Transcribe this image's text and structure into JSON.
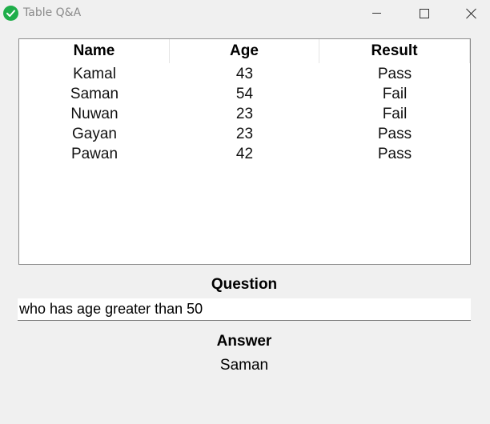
{
  "window": {
    "title": "Table Q&A",
    "icon": "check-circle-icon",
    "controls": [
      "minimize-icon",
      "maximize-icon",
      "close-icon"
    ]
  },
  "table": {
    "columns": [
      "Name",
      "Age",
      "Result"
    ],
    "rows": [
      [
        "Kamal",
        "43",
        "Pass"
      ],
      [
        "Saman",
        "54",
        "Fail"
      ],
      [
        "Nuwan",
        "23",
        "Fail"
      ],
      [
        "Gayan",
        "23",
        "Pass"
      ],
      [
        "Pawan",
        "42",
        "Pass"
      ]
    ]
  },
  "question": {
    "label": "Question",
    "value": "who has age greater than 50"
  },
  "answer": {
    "label": "Answer",
    "value": "Saman"
  },
  "colors": {
    "app_icon": "#1fae4a",
    "background": "#f0f0f0",
    "panel": "#ffffff"
  }
}
